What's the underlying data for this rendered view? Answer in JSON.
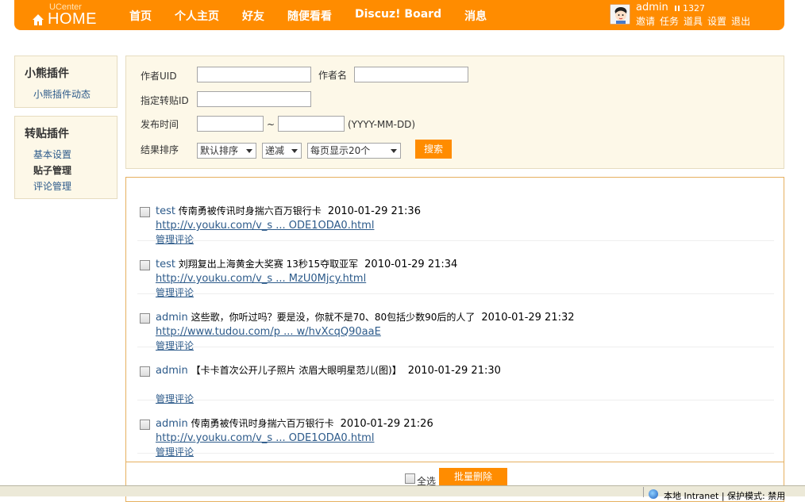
{
  "header": {
    "logo_small": "UCenter",
    "logo_big": "HOME",
    "nav": [
      "首页",
      "个人主页",
      "好友",
      "随便看看",
      "Discuz! Board",
      "消息"
    ],
    "username": "admin",
    "credits": "1327",
    "user_links": [
      "邀请",
      "任务",
      "道具",
      "设置",
      "退出"
    ]
  },
  "sidebar": {
    "box1": {
      "title": "小熊插件",
      "items": [
        "小熊插件动态"
      ]
    },
    "box2": {
      "title": "转贴插件",
      "items": [
        "基本设置",
        "贴子管理",
        "评论管理"
      ],
      "active_index": 1
    }
  },
  "search": {
    "author_uid_label": "作者UID",
    "author_name_label": "作者名",
    "repost_id_label": "指定转贴ID",
    "publish_time_label": "发布时间",
    "range_separator": "~",
    "date_format_hint": "(YYYY-MM-DD)",
    "sort_label": "结果排序",
    "sort_field": "默认排序",
    "sort_order": "递减",
    "page_size": "每页显示20个",
    "search_button": "搜索"
  },
  "posts": [
    {
      "author": "test",
      "title": "传南勇被传讯时身揣六百万银行卡",
      "time": "2010-01-29 21:36",
      "link": "http://v.youku.com/v_s ... ODE1ODA0.html",
      "manage": "管理评论"
    },
    {
      "author": "test",
      "title": "刘翔复出上海黄金大奖赛 13秒15夺取亚军",
      "time": "2010-01-29 21:34",
      "link": "http://v.youku.com/v_s ... MzU0Mjcy.html",
      "manage": "管理评论"
    },
    {
      "author": "admin",
      "title": "这些歌，你听过吗？要是没，你就不是70、80包括少数90后的人了",
      "time": "2010-01-29 21:32",
      "link": "http://www.tudou.com/p ... w/hvXcqQ90aaE",
      "manage": "管理评论"
    },
    {
      "author": "admin",
      "title": "【卡卡首次公开儿子照片 浓眉大眼明星范儿(图)】",
      "time": "2010-01-29 21:30",
      "link": "",
      "manage": "管理评论"
    },
    {
      "author": "admin",
      "title": "传南勇被传讯时身揣六百万银行卡",
      "time": "2010-01-29 21:26",
      "link": "http://v.youku.com/v_s ... ODE1ODA0.html",
      "manage": "管理评论"
    }
  ],
  "footer": {
    "select_all": "全选",
    "batch_delete": "批量删除"
  },
  "statusbar": {
    "zone": "本地 Intranet | 保护模式: 禁用"
  },
  "colors": {
    "brand_orange": "#ff8c00",
    "link_blue": "#2c5a8a",
    "panel_bg": "#fdf8e8"
  }
}
